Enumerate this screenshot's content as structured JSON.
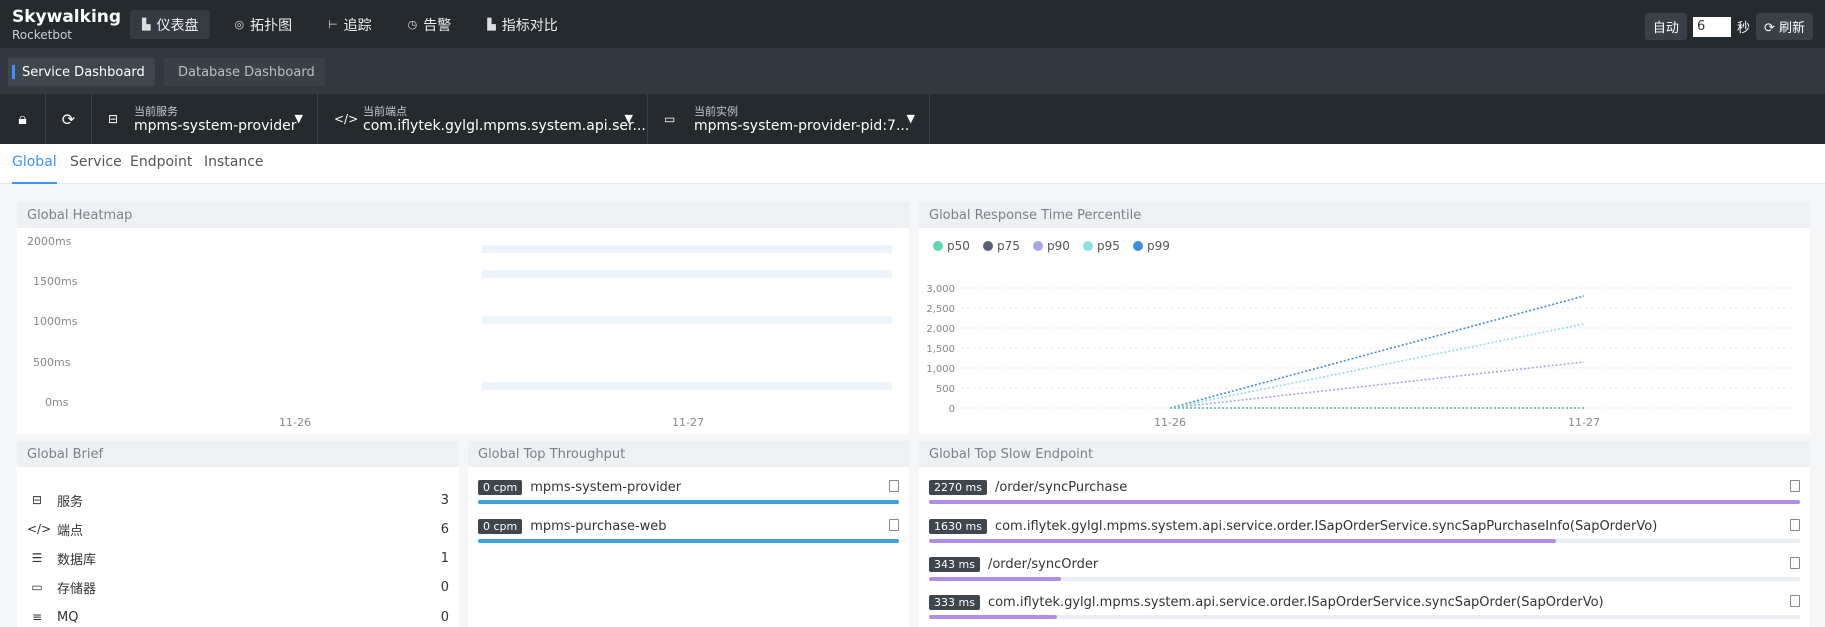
{
  "logo": {
    "line1": "Skywalking",
    "line2": "Rocketbot"
  },
  "nav": [
    {
      "label": "仪表盘",
      "icon": "dashboard-icon",
      "active": true
    },
    {
      "label": "拓扑图",
      "icon": "topology-icon"
    },
    {
      "label": "追踪",
      "icon": "trace-icon"
    },
    {
      "label": "告警",
      "icon": "alarm-icon"
    },
    {
      "label": "指标对比",
      "icon": "compare-icon"
    }
  ],
  "auto": {
    "label": "自动",
    "value": "6",
    "unit": "秒",
    "refresh": "刷新"
  },
  "dashboards": [
    {
      "label": "Service Dashboard",
      "active": true
    },
    {
      "label": "Database Dashboard"
    }
  ],
  "selectors": {
    "service": {
      "label": "当前服务",
      "value": "mpms-system-provider"
    },
    "endpoint": {
      "label": "当前端点",
      "value": "com.iflytek.gylgl.mpms.system.api.ser..."
    },
    "instance": {
      "label": "当前实例",
      "value": "mpms-system-provider-pid:7..."
    }
  },
  "tabs": [
    "Global",
    "Service",
    "Endpoint",
    "Instance"
  ],
  "heatmap": {
    "title": "Global Heatmap",
    "yticks": [
      "2000ms",
      "1500ms",
      "1000ms",
      "500ms",
      "0ms"
    ],
    "xticks": [
      "11-26",
      "11-27"
    ]
  },
  "percentile": {
    "title": "Global Response Time Percentile",
    "chart_data": {
      "type": "line",
      "x": [
        "11-26",
        "11-27"
      ],
      "yticks": [
        "3,000",
        "2,500",
        "2,000",
        "1,500",
        "1,000",
        "500",
        "0"
      ],
      "ylim": [
        0,
        3000
      ],
      "legend_position": "top-left",
      "series": [
        {
          "name": "p50",
          "color": "#5ed8b5",
          "values": [
            0,
            0
          ]
        },
        {
          "name": "p75",
          "color": "#5a6079",
          "values": [
            0,
            0
          ]
        },
        {
          "name": "p90",
          "color": "#a5a8e8",
          "values": [
            0,
            1150
          ]
        },
        {
          "name": "p95",
          "color": "#8fe0e6",
          "values": [
            0,
            2100
          ]
        },
        {
          "name": "p99",
          "color": "#3c8ee0",
          "values": [
            0,
            2800
          ]
        }
      ]
    }
  },
  "brief": {
    "title": "Global Brief",
    "items": [
      {
        "icon": "service-icon",
        "glyph": "⊟",
        "label": "服务",
        "value": "3"
      },
      {
        "icon": "endpoint-icon",
        "glyph": "</>",
        "label": "端点",
        "value": "6"
      },
      {
        "icon": "database-icon",
        "glyph": "☰",
        "label": "数据库",
        "value": "1"
      },
      {
        "icon": "storage-icon",
        "glyph": "▭",
        "label": "存储器",
        "value": "0"
      },
      {
        "icon": "mq-icon",
        "glyph": "≡",
        "label": "MQ",
        "value": "0"
      }
    ]
  },
  "throughput": {
    "title": "Global Top Throughput",
    "items": [
      {
        "tag": "0 cpm",
        "name": "mpms-system-provider",
        "fraction": 1.0
      },
      {
        "tag": "0 cpm",
        "name": "mpms-purchase-web",
        "fraction": 1.0
      }
    ]
  },
  "slow": {
    "title": "Global Top Slow Endpoint",
    "items": [
      {
        "tag": "2270 ms",
        "name": "/order/syncPurchase",
        "fraction": 1.0
      },
      {
        "tag": "1630 ms",
        "name": "com.iflytek.gylgl.mpms.system.api.service.order.ISapOrderService.syncSapPurchaseInfo(SapOrderVo)",
        "fraction": 0.72
      },
      {
        "tag": "343 ms",
        "name": "/order/syncOrder",
        "fraction": 0.151
      },
      {
        "tag": "333 ms",
        "name": "com.iflytek.gylgl.mpms.system.api.service.order.ISapOrderService.syncSapOrder(SapOrderVo)",
        "fraction": 0.147
      }
    ]
  }
}
